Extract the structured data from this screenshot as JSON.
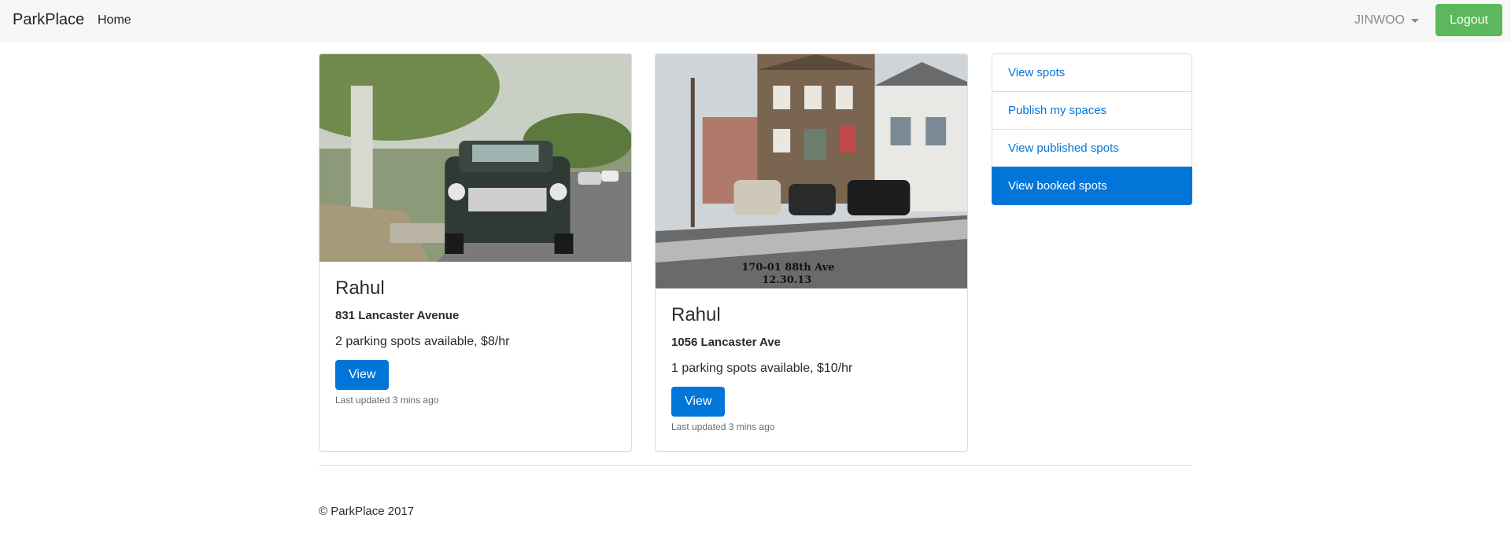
{
  "navbar": {
    "brand": "ParkPlace",
    "home": "Home",
    "user": "JINWOO",
    "logout": "Logout"
  },
  "cards": [
    {
      "title": "Rahul",
      "address": "831 Lancaster Avenue",
      "availability": "2 parking spots available, $8/hr",
      "button": "View",
      "updated": "Last updated 3 mins ago",
      "image_caption": ""
    },
    {
      "title": "Rahul",
      "address": "1056 Lancaster Ave",
      "availability": "1 parking spots available, $10/hr",
      "button": "View",
      "updated": "Last updated 3 mins ago",
      "image_caption_line1": "170-01 88th Ave",
      "image_caption_line2": "12.30.13"
    }
  ],
  "sidebar": {
    "items": [
      {
        "label": "View spots"
      },
      {
        "label": "Publish my spaces"
      },
      {
        "label": "View published spots"
      },
      {
        "label": "View booked spots"
      }
    ]
  },
  "footer": {
    "copyright": "© ParkPlace 2017"
  },
  "colors": {
    "primary": "#0275d8",
    "success": "#5cb85c",
    "navbar_bg": "#f7f7f7"
  }
}
